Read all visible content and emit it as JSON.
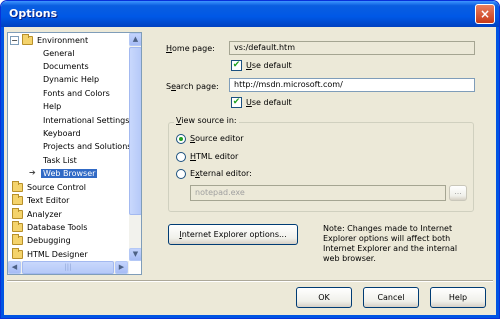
{
  "window": {
    "title": "Options",
    "close_glyph": "×"
  },
  "tree": {
    "items": [
      {
        "label": "Environment",
        "kind": "folder-open"
      },
      {
        "label": "General",
        "kind": "child"
      },
      {
        "label": "Documents",
        "kind": "child"
      },
      {
        "label": "Dynamic Help",
        "kind": "child"
      },
      {
        "label": "Fonts and Colors",
        "kind": "child"
      },
      {
        "label": "Help",
        "kind": "child"
      },
      {
        "label": "International Settings",
        "kind": "child"
      },
      {
        "label": "Keyboard",
        "kind": "child"
      },
      {
        "label": "Projects and Solutions",
        "kind": "child"
      },
      {
        "label": "Task List",
        "kind": "child"
      },
      {
        "label": "Web Browser",
        "kind": "child-selected"
      },
      {
        "label": "Source Control",
        "kind": "folder"
      },
      {
        "label": "Text Editor",
        "kind": "folder"
      },
      {
        "label": "Analyzer",
        "kind": "folder"
      },
      {
        "label": "Database Tools",
        "kind": "folder"
      },
      {
        "label": "Debugging",
        "kind": "folder"
      },
      {
        "label": "HTML Designer",
        "kind": "folder"
      }
    ],
    "expander": "−",
    "selection_arrow": "➔",
    "scroll_up": "▲",
    "scroll_down": "▼",
    "scroll_left": "◀",
    "scroll_right": "▶",
    "grip": "|||"
  },
  "home": {
    "label_pre": "",
    "label_u": "H",
    "label_post": "ome page:",
    "value": "vs:/default.htm",
    "use_default_u": "U",
    "use_default_rest": "se default",
    "checked": true
  },
  "search": {
    "label_pre": "S",
    "label_u": "e",
    "label_post": "arch page:",
    "value": "http://msdn.microsoft.com/",
    "use_default_u": "U",
    "use_default_rest": "se default",
    "checked": true
  },
  "check_glyph": "✔",
  "view_source": {
    "title_pre": "",
    "title_u": "V",
    "title_post": "iew source in:",
    "source_u": "S",
    "source_rest": "ource editor",
    "html_u": "H",
    "html_rest": "TML editor",
    "external_pre": "E",
    "external_u": "x",
    "external_rest": "ternal editor:",
    "external_value": "notepad.exe",
    "browse_label": "...",
    "selected": "source"
  },
  "ie_button": {
    "pre": "",
    "u": "I",
    "rest": "nternet Explorer options..."
  },
  "note": "Note: Changes made to Internet Explorer options will affect both Internet Explorer and the internal web browser.",
  "buttons": {
    "ok": "OK",
    "cancel": "Cancel",
    "help": "Help"
  }
}
